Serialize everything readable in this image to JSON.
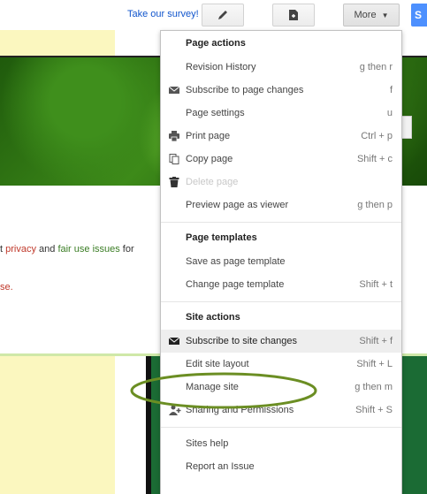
{
  "toolbar": {
    "survey_label": "Take our survey!",
    "more_label": "More",
    "share_label": "S"
  },
  "page": {
    "privacy_prefix": "t ",
    "privacy_link": "privacy",
    "privacy_and": " and ",
    "fair_use_link": "fair use issues",
    "privacy_suffix": " for",
    "se_text": "se."
  },
  "menu": {
    "page_actions_title": "Page actions",
    "page_actions": [
      {
        "label": "Revision History",
        "shortcut": "g then r",
        "icon": ""
      },
      {
        "label": "Subscribe to page changes",
        "shortcut": "f",
        "icon": "mail-icon"
      },
      {
        "label": "Page settings",
        "shortcut": "u",
        "icon": ""
      },
      {
        "label": "Print page",
        "shortcut": "Ctrl + p",
        "icon": "printer-icon"
      },
      {
        "label": "Copy page",
        "shortcut": "Shift + c",
        "icon": "copy-icon"
      },
      {
        "label": "Delete page",
        "shortcut": "",
        "icon": "trash-icon",
        "disabled": true
      },
      {
        "label": "Preview page as viewer",
        "shortcut": "g then p",
        "icon": ""
      }
    ],
    "page_templates_title": "Page templates",
    "page_templates": [
      {
        "label": "Save as page template",
        "shortcut": ""
      },
      {
        "label": "Change page template",
        "shortcut": "Shift + t"
      }
    ],
    "site_actions_title": "Site actions",
    "site_actions": [
      {
        "label": "Subscribe to site changes",
        "shortcut": "Shift + f",
        "icon": "mail-icon",
        "highlighted": true
      },
      {
        "label": "Edit site layout",
        "shortcut": "Shift + L",
        "icon": ""
      },
      {
        "label": "Manage site",
        "shortcut": "g then m",
        "icon": ""
      },
      {
        "label": "Sharing and Permissions",
        "shortcut": "Shift + S",
        "icon": "add-person-icon"
      }
    ],
    "help": [
      {
        "label": "Sites help"
      },
      {
        "label": "Report an Issue"
      }
    ]
  },
  "colors": {
    "annotation": "#6b8e23",
    "highlight": "#eeeeee",
    "link": "#1155cc"
  }
}
